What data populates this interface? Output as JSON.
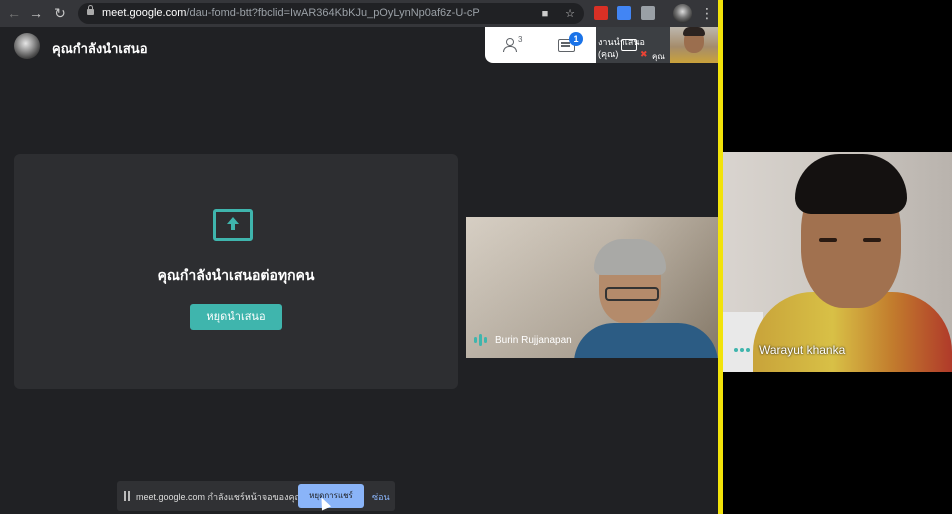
{
  "browser": {
    "url_host": "meet.google.com",
    "url_path": "/dau-fomd-btt?fbclid=IwAR364KbKJu_pOyLynNp0af6z-U-cP"
  },
  "meet": {
    "presenting_title": "คุณกำลังนำเสนอ",
    "people_count": "3",
    "chat_badge": "1",
    "self_tile_name": "งานนำเสนอ (คุณ)",
    "self_short_label": "คุณ"
  },
  "presentation": {
    "message": "คุณกำลังนำเสนอต่อทุกคน",
    "stop_button": "หยุดนำเสนอ"
  },
  "participants": [
    {
      "name": "Burin Rujjanapan"
    },
    {
      "name": "Warayut khanka"
    }
  ],
  "share_bar": {
    "text": "meet.google.com กำลังแชร์หน้าจอของคุณ",
    "stop_button": "หยุดการแชร์",
    "hide_button": "ซ่อน"
  },
  "colors": {
    "accent": "#3fb5ad",
    "divider": "#f2e30a",
    "blue": "#8ab4f8",
    "badge": "#1a73e8"
  },
  "icons": {
    "people": "people-icon",
    "chat": "chat-icon",
    "present": "present-screen-icon",
    "mute": "mic-off-icon"
  }
}
